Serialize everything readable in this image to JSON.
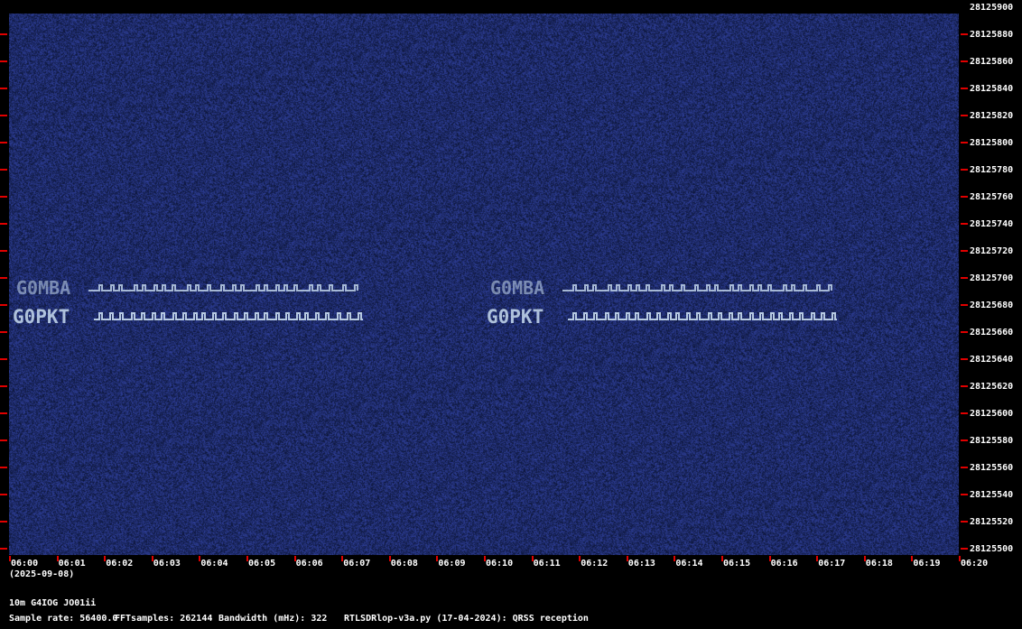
{
  "plot": {
    "background": "#13336f",
    "signal_color": "#c8dcf0",
    "tick_color": "#e00000",
    "frequency_labels": [
      "28125900",
      "28125880",
      "28125860",
      "28125840",
      "28125820",
      "28125800",
      "28125780",
      "28125760",
      "28125740",
      "28125720",
      "28125700",
      "28125680",
      "28125660",
      "28125640",
      "28125620",
      "28125600",
      "28125580",
      "28125560",
      "28125540",
      "28125520",
      "28125500"
    ],
    "time_labels": [
      "06:00",
      "06:01",
      "06:02",
      "06:03",
      "06:04",
      "06:05",
      "06:06",
      "06:07",
      "06:08",
      "06:09",
      "06:10",
      "06:11",
      "06:12",
      "06:13",
      "06:14",
      "06:15",
      "06:16",
      "06:17",
      "06:18",
      "06:19",
      "06:20"
    ],
    "date_label": "(2025-09-08)",
    "callsigns": [
      "G0MBA",
      "G0PKT"
    ]
  },
  "info": {
    "station": "10m G4IOG JO01ii",
    "sample_rate": "Sample rate: 56400.0",
    "fft_samples": "FFTsamples: 262144",
    "bandwidth": "Bandwidth (mHz): 322",
    "software": "RTLSDRlop-v3a.py (17-04-2024): QRSS reception"
  }
}
